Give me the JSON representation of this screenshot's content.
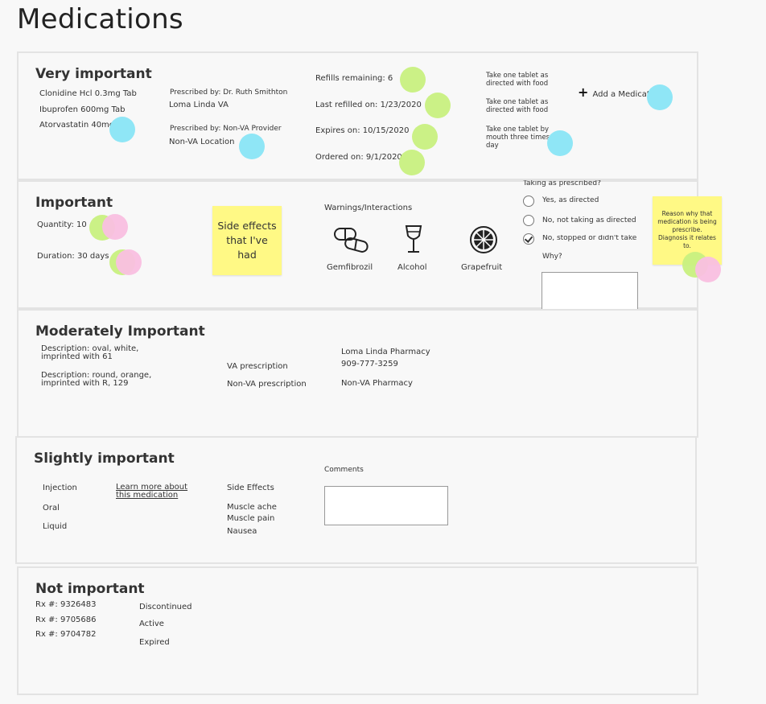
{
  "page": {
    "title": "Medications"
  },
  "very_important": {
    "title": "Very important",
    "meds": [
      "Clonidine Hcl 0.3mg Tab",
      "Ibuprofen 600mg Tab",
      "Atorvastatin 40mg"
    ],
    "prescribers": [
      {
        "label": "Prescribed by: Dr. Ruth Smithton",
        "location": "Loma Linda VA"
      },
      {
        "label": "Prescribed by: Non-VA Provider",
        "location": "Non-VA Location"
      }
    ],
    "refills_remaining": "Refills remaining: 6",
    "last_refilled": "Last refilled on: 1/23/2020",
    "expires": "Expires on: 10/15/2020",
    "ordered": "Ordered on: 9/1/2020",
    "instructions": [
      "Take one tablet as directed with food",
      "Take one tablet as directed with food",
      "Take one tablet by mouth three times a day"
    ],
    "add_label": "Add a Medication"
  },
  "important": {
    "title": "Important",
    "quantity": "Quantity: 10",
    "duration": "Duration: 30 days",
    "sticky_side_effects": "Side effects that I've had",
    "warnings_title": "Warnings/Interactions",
    "warnings": [
      {
        "label": "Gemfibrozil",
        "icon": "pill-capsule-icon"
      },
      {
        "label": "Alcohol",
        "icon": "wine-glass-icon"
      },
      {
        "label": "Grapefruit",
        "icon": "grapefruit-icon"
      }
    ],
    "taking_question": "Taking as prescribed?",
    "options": [
      "Yes, as directed",
      "No, not taking as directed",
      "No, stopped or didn't take"
    ],
    "selected_option": 2,
    "why_label": "Why?",
    "sticky_reason": "Reason why that medication is being prescribe. Diagnosis it relates to."
  },
  "moderately_important": {
    "title": "Moderately Important",
    "descriptions": [
      "Description: oval, white, imprinted with 61",
      "Description: round, orange, imprinted with R, 129"
    ],
    "prescription_types": [
      "VA prescription",
      "Non-VA prescription"
    ],
    "pharmacy_name": "Loma Linda Pharmacy",
    "pharmacy_phone": "909-777-3259",
    "non_va_pharmacy": "Non-VA Pharmacy"
  },
  "slightly_important": {
    "title": "Slightly important",
    "routes": [
      "Injection",
      "Oral",
      "Liquid"
    ],
    "learn_more": "Learn more about this medication",
    "side_effects_title": "Side Effects",
    "side_effects": [
      "Muscle ache",
      "Muscle pain",
      "Nausea"
    ],
    "comments_label": "Comments"
  },
  "not_important": {
    "title": "Not important",
    "rx_numbers": [
      "Rx #: 9326483",
      "Rx #: 9705686",
      "Rx #: 9704782"
    ],
    "statuses": [
      "Discontinued",
      "Active",
      "Expired"
    ]
  },
  "colors": {
    "green_dot": "#c8f07f",
    "blue_dot": "#8fe6f6",
    "pink_dot": "#f9bfe0",
    "sticky": "#fff985"
  }
}
